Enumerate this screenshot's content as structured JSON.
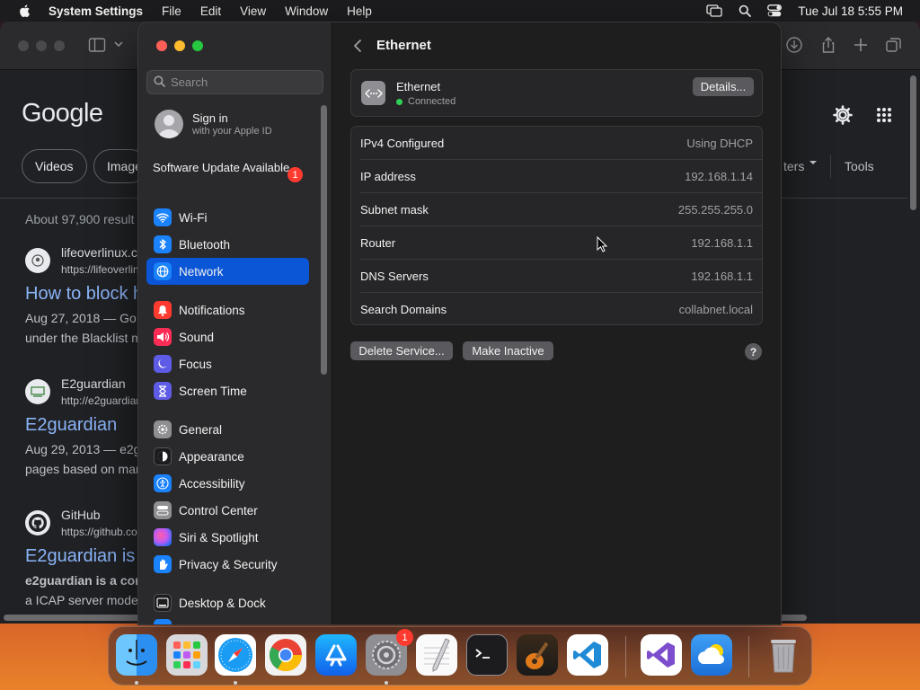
{
  "menubar": {
    "app_name": "System Settings",
    "items": [
      "File",
      "Edit",
      "View",
      "Window",
      "Help"
    ],
    "clock": "Tue Jul 18  5:55 PM"
  },
  "browser": {
    "logo": "Google",
    "chips": [
      "Videos",
      "Image"
    ],
    "filters_label": "ters",
    "tools_label": "Tools",
    "results_count": "About 97,900 result",
    "results": [
      {
        "site": "lifeoverlinux.c",
        "url": "https://lifeoverlin",
        "title": "How to block h",
        "snippet1": "Aug 27, 2018 — Go",
        "snippet2": "under the Blacklist m"
      },
      {
        "site": "E2guardian",
        "url": "http://e2guardiar",
        "title": "E2guardian",
        "snippet1": "Aug 29, 2013 — e2g",
        "snippet2": "pages based on mar"
      },
      {
        "site": "GitHub",
        "url": "https://github.co",
        "title": "E2guardian is",
        "snippet1": "e2guardian is a con",
        "snippet2": "a ICAP server mode"
      }
    ]
  },
  "sidebar": {
    "search_placeholder": "Search",
    "account_title": "Sign in",
    "account_subtitle": "with your Apple ID",
    "software_update": "Software Update Available",
    "software_update_badge": "1",
    "items": [
      {
        "label": "Wi-Fi",
        "icon": "wifi-icon",
        "color": "#1a82fb"
      },
      {
        "label": "Bluetooth",
        "icon": "bluetooth-icon",
        "color": "#1a82fb"
      },
      {
        "label": "Network",
        "icon": "globe-icon",
        "color": "#1a82fb",
        "selected": true
      },
      {
        "label": "Notifications",
        "icon": "bell-icon",
        "color": "#ff3b30"
      },
      {
        "label": "Sound",
        "icon": "speaker-icon",
        "color": "#ff2d55"
      },
      {
        "label": "Focus",
        "icon": "moon-icon",
        "color": "#5e5ce6"
      },
      {
        "label": "Screen Time",
        "icon": "hourglass-icon",
        "color": "#5e5ce6"
      },
      {
        "label": "General",
        "icon": "gear-icon",
        "color": "#8e8e93"
      },
      {
        "label": "Appearance",
        "icon": "appearance-icon",
        "color": "#1c1c1e"
      },
      {
        "label": "Accessibility",
        "icon": "accessibility-icon",
        "color": "#1a82fb"
      },
      {
        "label": "Control Center",
        "icon": "control-center-icon",
        "color": "#8e8e93"
      },
      {
        "label": "Siri & Spotlight",
        "icon": "siri-icon",
        "color": "#bf5af2"
      },
      {
        "label": "Privacy & Security",
        "icon": "hand-icon",
        "color": "#1a82fb"
      },
      {
        "label": "Desktop & Dock",
        "icon": "dock-icon",
        "color": "#1c1c1e"
      }
    ]
  },
  "content": {
    "title": "Ethernet",
    "service": {
      "name": "Ethernet",
      "status": "Connected",
      "details_button": "Details..."
    },
    "rows": [
      {
        "label": "IPv4 Configured",
        "value": "Using DHCP"
      },
      {
        "label": "IP address",
        "value": "192.168.1.14"
      },
      {
        "label": "Subnet mask",
        "value": "255.255.255.0"
      },
      {
        "label": "Router",
        "value": "192.168.1.1"
      },
      {
        "label": "DNS Servers",
        "value": "192.168.1.1"
      },
      {
        "label": "Search Domains",
        "value": "collabnet.local"
      }
    ],
    "delete_button": "Delete Service...",
    "inactive_button": "Make Inactive",
    "help_button": "?"
  },
  "dock": {
    "settings_badge": "1",
    "apps": [
      "Finder",
      "Launchpad",
      "Safari",
      "Chrome",
      "App Store",
      "System Settings",
      "TextEdit",
      "Terminal",
      "GarageBand",
      "Visual Studio Code",
      "Visual Studio",
      "Weather",
      "Trash"
    ]
  },
  "colors": {
    "accent": "#0b56d6",
    "status_connected": "#30d158",
    "badge": "#ff3b30",
    "link": "#8ab4f8"
  }
}
